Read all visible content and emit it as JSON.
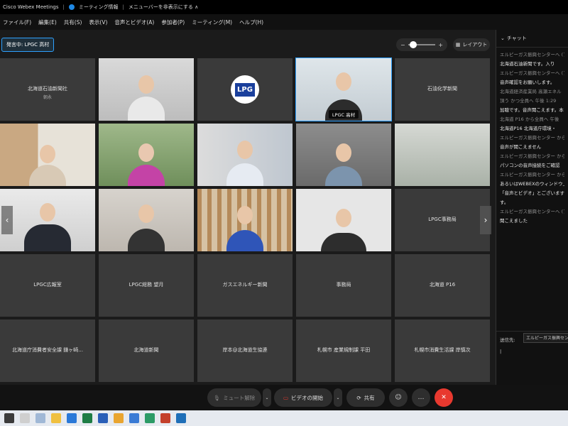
{
  "titlebar": {
    "app": "Cisco Webex Meetings",
    "sep": "|",
    "meeting_info": "ミーティング情報",
    "hide_menu": "メニューバーを非表示にする ∧"
  },
  "menubar": {
    "items": [
      "ファイル(F)",
      "編集(E)",
      "共有(S)",
      "表示(V)",
      "音声とビデオ(A)",
      "参加者(P)",
      "ミーティング(M)",
      "ヘルプ(H)"
    ]
  },
  "stage": {
    "speaking": "発言中: LPGC 高村",
    "layout_label": "レイアウト",
    "prev_arrow": "‹",
    "next_arrow": "›",
    "tiles": {
      "r1c1_label": "北海道石油新聞社",
      "r1c1_sub": "朝永",
      "r1c4_name": "LPGC 高村",
      "r1c5_label": "石油化学新聞",
      "r3c5_label": "LPGC事務局",
      "r4c1_label": "LPGC広報室",
      "r4c2_label": "LPGC総務 望月",
      "r4c3_label": "ガスエネルギー新聞",
      "r4c4_label": "事務局",
      "r4c5_label": "北海道 P16",
      "r5c1_label": "北海道庁消費者安全課 鎌ヶ崎...",
      "r5c2_label": "北海道新聞",
      "r5c3_label": "岸本@北海道生協連",
      "r5c4_label": "札幌市 産業規制課 平田",
      "r5c5_label": "札幌市消費生活課 岸慎次"
    },
    "logo_text": "LPG"
  },
  "chat": {
    "title": "チャット",
    "messages": [
      {
        "meta": "エルピーガス振興センターへ (プ"
      },
      {
        "body": "北海道石油新聞です。入り"
      },
      {
        "meta": "エルピーガス振興センターへ (プ"
      },
      {
        "body": "音声確認をお願いします。"
      },
      {
        "meta": "北海道経済産業局 高瀬エネル"
      },
      {
        "meta": "頂う かつ全員へ 午後 1:29"
      },
      {
        "body": "加聴です。音声聞こえます。本"
      },
      {
        "meta": "北海道 P16 から全員へ 午後"
      },
      {
        "body": "北海道P16 北海道庁環境・"
      },
      {
        "meta": "エルピーガス振興センター から"
      },
      {
        "body": "音声が聞こえません"
      },
      {
        "meta": "エルピーガス振興センター から"
      },
      {
        "body": "パソコンの音声接続をご確認"
      },
      {
        "meta": "エルピーガス振興センター から"
      },
      {
        "body": "あるいはWEBEXのウィンドウ上"
      },
      {
        "body": "「音声とビデオ」とございますの"
      },
      {
        "body": "す。"
      },
      {
        "meta": "エルピーガス振興センターへ (プ"
      },
      {
        "body": "聞こえました"
      }
    ],
    "to_label": "送信先:",
    "to_target": "エルピーガス振興セン",
    "input_value": "|"
  },
  "toolbar": {
    "mute": "ミュート解除",
    "video": "ビデオの開始",
    "share": "共有",
    "more": "…",
    "end": "✕"
  },
  "colors": {
    "accent": "#2ea1ff",
    "end_call": "#e8392f",
    "tile_bg": "#3a3a3a"
  }
}
